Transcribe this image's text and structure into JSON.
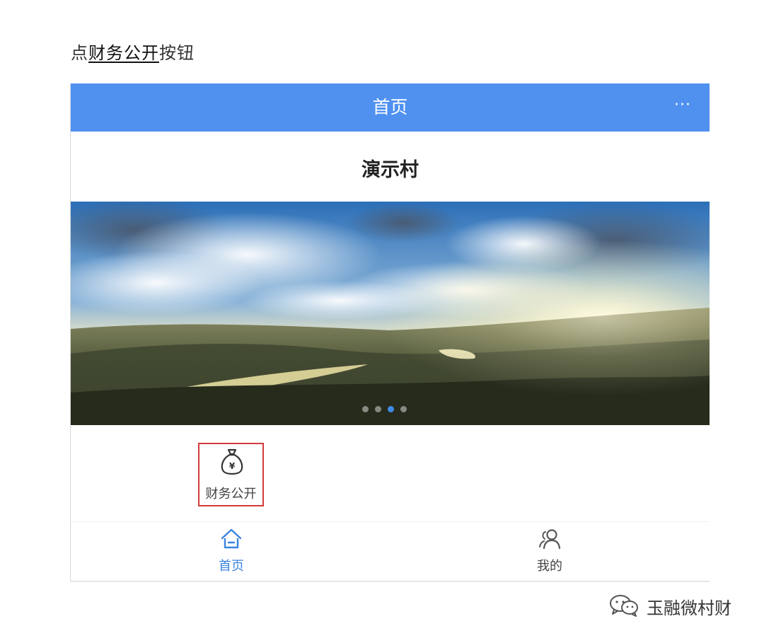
{
  "instruction": {
    "prefix": "点",
    "emphasis": "财务公开",
    "suffix": "按钮"
  },
  "navbar": {
    "title": "首页",
    "more": "···",
    "color": "#5091f0"
  },
  "village_title": "演示村",
  "banner": {
    "slide_count": 4,
    "active_index": 2,
    "active_dot_color": "#3f8be8"
  },
  "menu": {
    "items": [
      {
        "label": "财务公开",
        "icon": "money-bag-icon",
        "highlight_color": "#d23a3a"
      }
    ]
  },
  "tabbar": {
    "tabs": [
      {
        "label": "首页",
        "icon": "home-icon",
        "active": true,
        "color": "#3b84e0"
      },
      {
        "label": "我的",
        "icon": "users-icon",
        "active": false,
        "color": "#444444"
      }
    ]
  },
  "watermark": {
    "text": "玉融微村财",
    "icon": "wechat-icon"
  }
}
